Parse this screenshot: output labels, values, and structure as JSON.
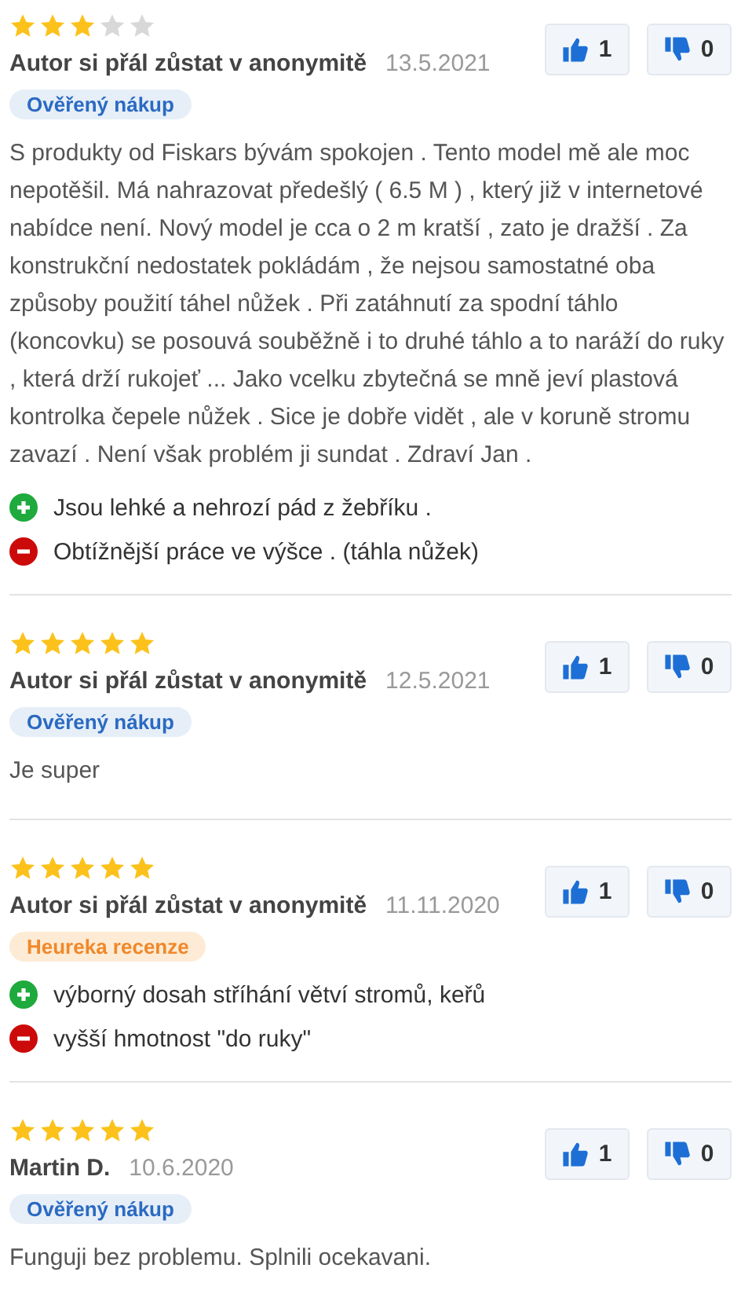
{
  "reviews": [
    {
      "stars": 3,
      "author": "Autor si přál zůstat v anonymitě",
      "date": "13.5.2021",
      "badge": {
        "kind": "verified",
        "label": "Ověřený nákup"
      },
      "votes": {
        "up": "1",
        "down": "0"
      },
      "text": "S produkty od Fiskars bývám spokojen . Tento model mě ale moc nepotěšil. Má nahrazovat předešlý ( 6.5 M ) , který již v internetové nabídce není. Nový model je cca o 2 m kratší , zato je dražší . Za konstrukční nedostatek pokládám , že nejsou samostatné oba způsoby použití táhel nůžek . Při zatáhnutí za spodní táhlo (koncovku) se posouvá souběžně i to druhé táhlo a to naráží do ruky , která drží rukojeť ... Jako vcelku zbytečná se mně jeví plastová kontrolka čepele nůžek . Sice je dobře vidět , ale v koruně stromu zavazí . Není však problém ji sundat . Zdraví Jan .",
      "points": [
        {
          "kind": "pro",
          "text": "Jsou lehké a nehrozí pád z žebříku ."
        },
        {
          "kind": "con",
          "text": "Obtížnější práce ve výšce . (táhla nůžek)"
        }
      ]
    },
    {
      "stars": 5,
      "author": "Autor si přál zůstat v anonymitě",
      "date": "12.5.2021",
      "badge": {
        "kind": "verified",
        "label": "Ověřený nákup"
      },
      "votes": {
        "up": "1",
        "down": "0"
      },
      "text": "Je super"
    },
    {
      "stars": 5,
      "author": "Autor si přál zůstat v anonymitě",
      "date": "11.11.2020",
      "badge": {
        "kind": "heureka",
        "label": "Heureka recenze"
      },
      "votes": {
        "up": "1",
        "down": "0"
      },
      "points": [
        {
          "kind": "pro",
          "text": "výborný dosah stříhání větví stromů, keřů"
        },
        {
          "kind": "con",
          "text": "vyšší hmotnost \"do ruky\""
        }
      ]
    },
    {
      "stars": 5,
      "author": "Martin D.",
      "date": "10.6.2020",
      "badge": {
        "kind": "verified",
        "label": "Ověřený nákup"
      },
      "votes": {
        "up": "1",
        "down": "0"
      },
      "text": "Funguji bez problemu. Splnili ocekavani."
    }
  ]
}
